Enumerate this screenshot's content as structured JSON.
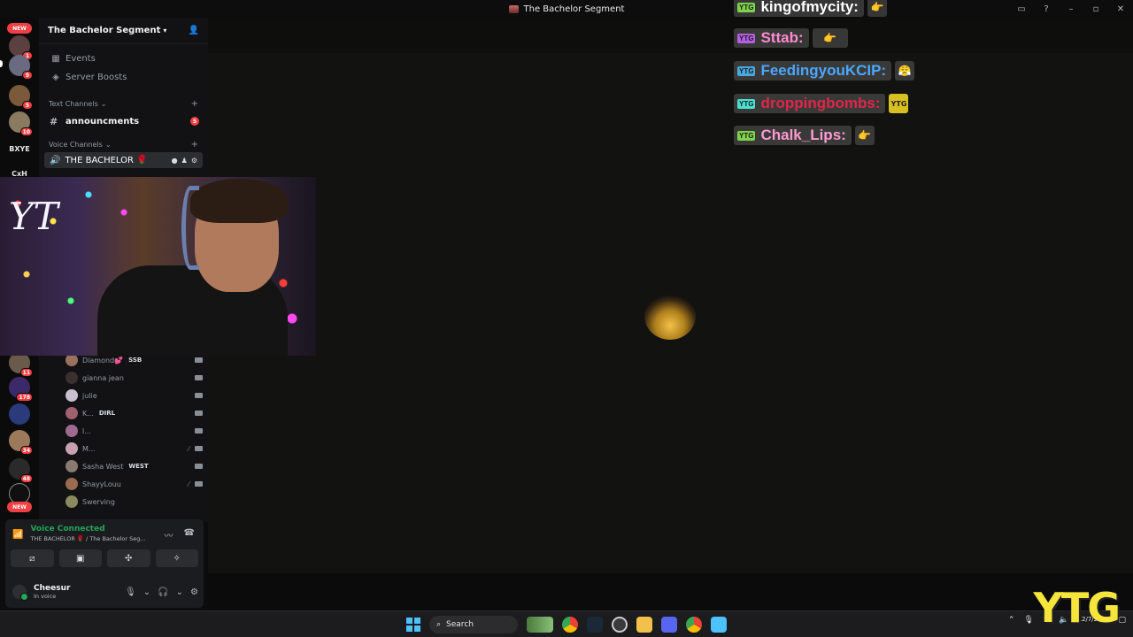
{
  "window": {
    "title": "The Bachelor Segment"
  },
  "rail": {
    "new_label": "NEW",
    "badges": [
      "1",
      "9",
      "5",
      "10",
      "6",
      "11",
      "178",
      "34",
      "48"
    ],
    "text_servers": [
      "BXYE",
      "CxH"
    ],
    "bottom_new_label": "NEW"
  },
  "guild": {
    "name": "The Bachelor Segment"
  },
  "sidebar": {
    "events_label": "Events",
    "boosts_label": "Server Boosts",
    "text_category": "Text Channels",
    "text_channel": "announcments",
    "text_channel_mentions": "5",
    "voice_category": "Voice Channels",
    "voice_channel": "THE BACHELOR 🌹"
  },
  "voice_users": [
    {
      "name": "Diamond💕",
      "tag": "SSB",
      "color": "#9a7060",
      "muted": false
    },
    {
      "name": "gianna jean",
      "tag": "",
      "color": "#3a3030",
      "muted": false
    },
    {
      "name": "julie",
      "tag": "",
      "color": "#c8c0d0",
      "muted": false
    },
    {
      "name": "K...",
      "tag": "DIRL",
      "color": "#a06070",
      "muted": false
    },
    {
      "name": "l...",
      "tag": "",
      "color": "#a06a90",
      "muted": false
    },
    {
      "name": "M...",
      "tag": "",
      "color": "#c9a0b0",
      "muted": true
    },
    {
      "name": "Sasha West",
      "tag": "WEST",
      "color": "#8a7a70",
      "muted": false
    },
    {
      "name": "ShayyLouu",
      "tag": "",
      "color": "#9a6a50",
      "muted": true
    },
    {
      "name": "Swerving",
      "tag": "",
      "color": "#8a8a60",
      "muted": false
    }
  ],
  "voice_panel": {
    "status": "Voice Connected",
    "location": "THE BACHELOR 🌹 / The Bachelor Seg..."
  },
  "user": {
    "name": "Cheesur",
    "status": "In voice"
  },
  "chat": [
    {
      "badge": "YTG",
      "badge_color": "#7fd34a",
      "name": "kingofmycity:",
      "name_color": "#ffffff",
      "emote": "👉"
    },
    {
      "badge": "YTG",
      "badge_color": "#b35fe0",
      "name": "Sttab:",
      "name_color": "#ff8ad0",
      "emote": "👉"
    },
    {
      "badge": "YTG",
      "badge_color": "#4aa8e0",
      "name": "FeedingyouKCIP:",
      "name_color": "#4aa8ff",
      "emote": "😤"
    },
    {
      "badge": "YTG",
      "badge_color": "#4ae0d0",
      "name": "droppingbombs:",
      "name_color": "#e0264a",
      "emote": "YTG"
    },
    {
      "badge": "YTG",
      "badge_color": "#7fd34a",
      "name": "Chalk_Lips:",
      "name_color": "#ff9ad0",
      "emote": "👉"
    }
  ],
  "cam_text": "YT",
  "watermark": "YTG",
  "taskbar": {
    "search_label": "Search",
    "date": "12/7/2025"
  }
}
